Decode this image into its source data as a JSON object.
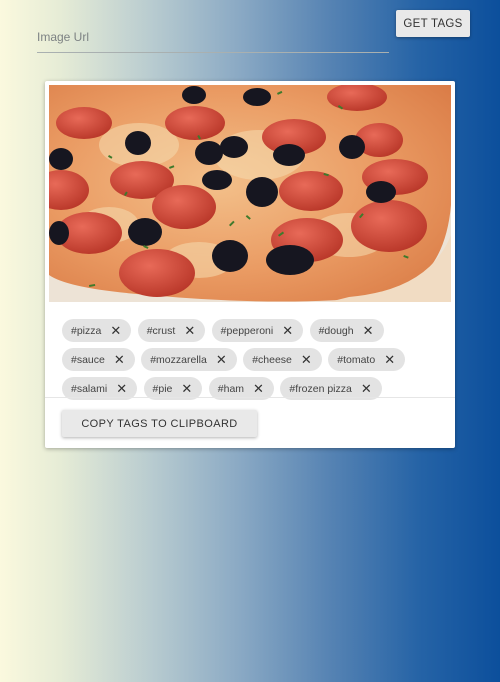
{
  "form": {
    "url_input": {
      "placeholder": "Image Url",
      "value": ""
    },
    "get_tags_label": "GET TAGS"
  },
  "image_card": {
    "image_subject": "pepperoni pizza with black olives",
    "tags": [
      {
        "label": "#pizza"
      },
      {
        "label": "#crust"
      },
      {
        "label": "#pepperoni"
      },
      {
        "label": "#dough"
      },
      {
        "label": "#sauce"
      },
      {
        "label": "#mozzarella"
      },
      {
        "label": "#cheese"
      },
      {
        "label": "#tomato"
      },
      {
        "label": "#salami"
      },
      {
        "label": "#pie"
      },
      {
        "label": "#ham"
      },
      {
        "label": "#frozen pizza"
      }
    ],
    "remove_symbol": "✕",
    "copy_label": "COPY TAGS TO CLIPBOARD"
  }
}
